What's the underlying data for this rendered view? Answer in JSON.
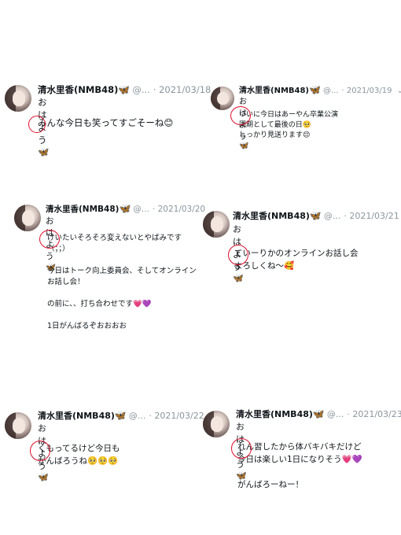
{
  "tweets": [
    {
      "name": "清水里香(NMB48)",
      "emoji": "🦋",
      "handle": "@...",
      "date": "· 2021/03/18",
      "greeting": "おはよう🦋",
      "lines": [
        "みんな今日も笑ってすごそーね😊"
      ]
    },
    {
      "name": "清水里香(NMB48)",
      "emoji": "🦋",
      "handle": "@...",
      "date": "· 2021/03/19",
      "greeting": "おはよう🦋",
      "lines": [
        "ついに今日はあーやん卒業公演",
        "同期として最後の日🥺",
        "しっかり見送ります😌"
      ]
    },
    {
      "name": "清水里香(NMB48)",
      "emoji": "🦋",
      "handle": "@...",
      "date": "· 2021/03/20",
      "greeting": "おはよう🦋",
      "lines": [
        "けいたいそろそろ変えないとやばみです",
        "（；；）",
        "",
        "今日はトーク向上委員会、そしてオンライン",
        "お話し会！",
        "",
        "の前に、、打ち合わせです💗💜",
        "",
        "1日がんばるぞおおおお"
      ]
    },
    {
      "name": "清水里香(NMB48)",
      "emoji": "🦋",
      "handle": "@...",
      "date": "· 2021/03/21",
      "greeting": "おはよう🦋",
      "lines": [
        "ていーりかのオンラインお話し会",
        "よろしくね〜🥰"
      ]
    },
    {
      "name": "清水里香(NMB48)",
      "emoji": "🦋",
      "handle": "@...",
      "date": "· 2021/03/22",
      "greeting": "おはよう🦋",
      "lines": [
        "くもってるけど今日も",
        "がんばろうね🥺🥺🥺"
      ]
    },
    {
      "name": "清水里香(NMB48)",
      "emoji": "🦋",
      "handle": "@...",
      "date": "· 2021/03/23",
      "greeting": "おはよう🦋",
      "lines": [
        "れん習したから体バキバキだけど",
        "今日は楽しい1日になりそう💗💜",
        "",
        "がんばろーねー！"
      ]
    }
  ]
}
